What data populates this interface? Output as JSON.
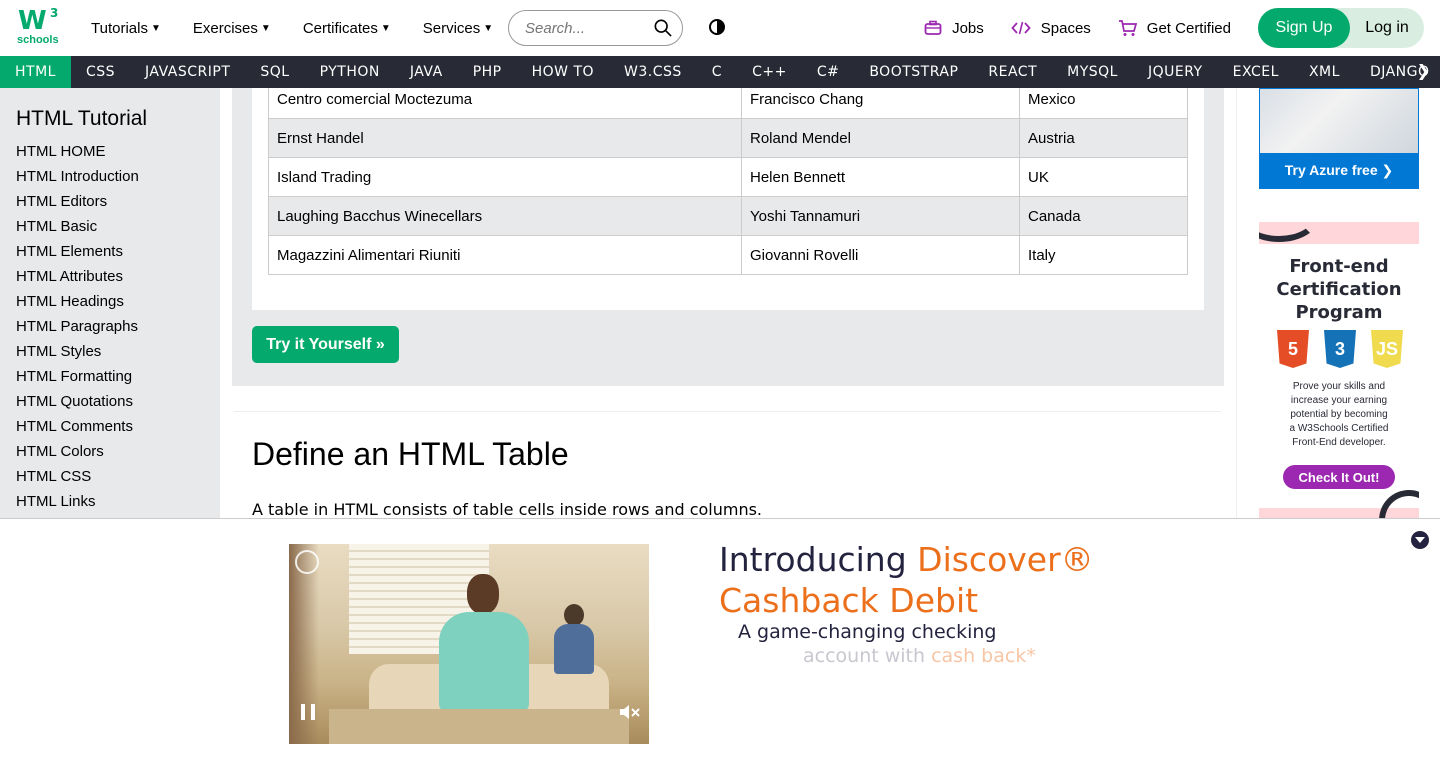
{
  "topnav": {
    "logo_text": "W3",
    "logo_sup": "3",
    "logo_sub": "schools",
    "menu": [
      {
        "label": "Tutorials"
      },
      {
        "label": "Exercises"
      },
      {
        "label": "Certificates"
      },
      {
        "label": "Services"
      }
    ],
    "search_placeholder": "Search...",
    "jobs": "Jobs",
    "spaces": "Spaces",
    "get_certified": "Get Certified",
    "signup": "Sign Up",
    "login": "Log in"
  },
  "subnav": {
    "items": [
      "HTML",
      "CSS",
      "JAVASCRIPT",
      "SQL",
      "PYTHON",
      "JAVA",
      "PHP",
      "HOW TO",
      "W3.CSS",
      "C",
      "C++",
      "C#",
      "BOOTSTRAP",
      "REACT",
      "MYSQL",
      "JQUERY",
      "EXCEL",
      "XML",
      "DJANGO"
    ],
    "active": "HTML",
    "next": "❯"
  },
  "sidebar": {
    "title": "HTML Tutorial",
    "links": [
      "HTML HOME",
      "HTML Introduction",
      "HTML Editors",
      "HTML Basic",
      "HTML Elements",
      "HTML Attributes",
      "HTML Headings",
      "HTML Paragraphs",
      "HTML Styles",
      "HTML Formatting",
      "HTML Quotations",
      "HTML Comments",
      "HTML Colors",
      "HTML CSS",
      "HTML Links"
    ]
  },
  "example": {
    "rows": [
      [
        "Centro comercial Moctezuma",
        "Francisco Chang",
        "Mexico"
      ],
      [
        "Ernst Handel",
        "Roland Mendel",
        "Austria"
      ],
      [
        "Island Trading",
        "Helen Bennett",
        "UK"
      ],
      [
        "Laughing Bacchus Winecellars",
        "Yoshi Tannamuri",
        "Canada"
      ],
      [
        "Magazzini Alimentari Riuniti",
        "Giovanni Rovelli",
        "Italy"
      ]
    ],
    "try_button": "Try it Yourself »"
  },
  "section": {
    "title": "Define an HTML Table",
    "text": "A table in HTML consists of table cells inside rows and columns."
  },
  "ads": {
    "azure_button": "Try Azure free ❯",
    "cert_title_lines": [
      "Front-end",
      "Certification",
      "Program"
    ],
    "badges": [
      {
        "label": "5",
        "color": "#E44D26"
      },
      {
        "label": "3",
        "color": "#1572B6"
      },
      {
        "label": "JS",
        "color": "#F0DB4F"
      }
    ],
    "cert_desc_lines": [
      "Prove your skills and",
      "increase your earning",
      "potential by becoming",
      "a W3Schools Certified",
      "Front-End developer."
    ],
    "cert_button": "Check It Out!"
  },
  "bottom_ad": {
    "headline_1": "Introducing ",
    "headline_brand": "Discover®",
    "headline_2": "Cashback Debit",
    "sub_1": "A game-changing checking",
    "sub_2_prefix": "account with ",
    "sub_2_highlight": "cash back*"
  },
  "colors": {
    "brand_green": "#04AA6D",
    "nav_dark": "#282A35",
    "sidebar_gray": "#E7E9EB",
    "discover_orange": "#EC6F1C",
    "azure_blue": "#0078D4",
    "purple": "#9C27B0"
  }
}
